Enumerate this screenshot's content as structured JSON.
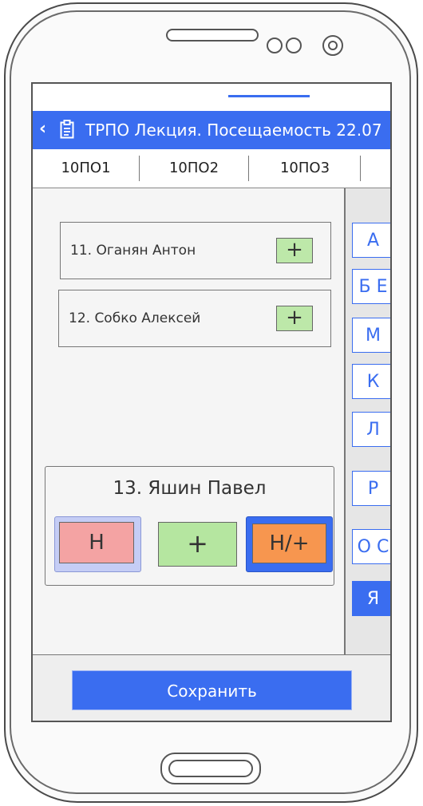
{
  "appbar": {
    "title": "ТРПО Лекция. Посещаемость 22.07"
  },
  "tabs": [
    {
      "label": "10ПО1",
      "active": false
    },
    {
      "label": "10ПО2",
      "active": false
    },
    {
      "label": "10ПО3",
      "active": true
    }
  ],
  "students": [
    {
      "label": "11. Оганян Антон",
      "mark": "+"
    },
    {
      "label": "12. Собко Алексей",
      "mark": "+"
    }
  ],
  "selected_student": {
    "label": "13. Яшин Павел",
    "options": [
      {
        "label": "Н",
        "color": "#f4a3a3",
        "selected": true
      },
      {
        "label": "+",
        "color": "#b5e6a0",
        "selected": false
      },
      {
        "label": "Н/+",
        "color": "#f7964f",
        "selected": true
      }
    ]
  },
  "alphabet_index": [
    {
      "label": "А",
      "active": false
    },
    {
      "label": "Б Е",
      "active": false
    },
    {
      "label": "М",
      "active": false
    },
    {
      "label": "К",
      "active": false
    },
    {
      "label": "Л",
      "active": false
    },
    {
      "label": "Р",
      "active": false
    },
    {
      "label": "О С",
      "active": false
    },
    {
      "label": "Я",
      "active": true
    }
  ],
  "bottom": {
    "save_label": "Сохранить"
  },
  "colors": {
    "accent": "#3a6df0",
    "plus_green": "#bde8a9",
    "absent_red": "#f4a3a3",
    "late_orange": "#f7964f"
  }
}
